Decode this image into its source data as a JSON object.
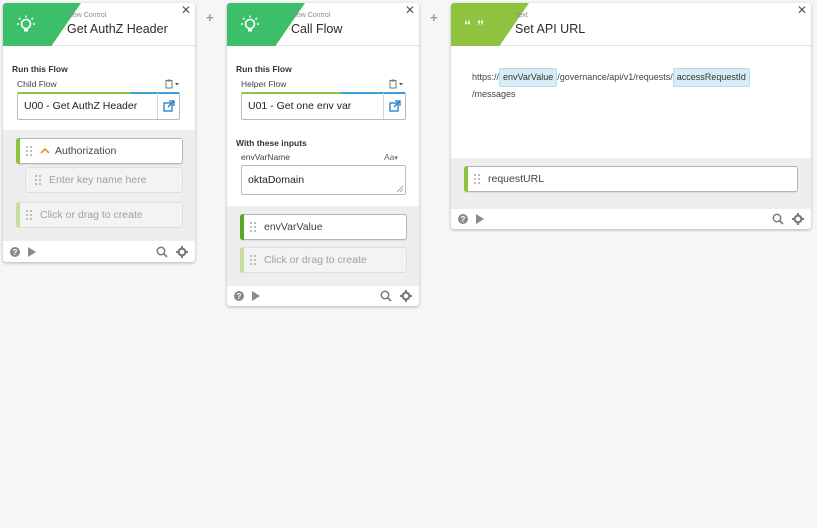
{
  "cards": [
    {
      "type_label": "Flow Control",
      "title": "Get AuthZ Header",
      "run_label": "Run this Flow",
      "field_label": "Child Flow",
      "flow_value": "U00 - Get AuthZ Header",
      "pills": {
        "key": "Authorization",
        "key_placeholder": "Enter key name here",
        "create": "Click or drag to create"
      }
    },
    {
      "type_label": "Flow Control",
      "title": "Call Flow",
      "run_label": "Run this Flow",
      "field_label": "Helper Flow",
      "flow_value": "U01 - Get one env var",
      "inputs_label": "With these inputs",
      "input_name": "envVarName",
      "input_type": "Aa",
      "input_value": "oktaDomain",
      "pills": {
        "output": "envVarValue",
        "create": "Click or drag to create"
      }
    },
    {
      "type_label": "Text",
      "title": "Set API URL",
      "badge_glyph": "“ ”",
      "template": {
        "part1": "https://",
        "token1": "envVarValue",
        "part2": "/governance/api/v1/requests/",
        "token2": "accessRequestId",
        "part3": "/messages"
      },
      "pills": {
        "output": "requestURL"
      }
    }
  ],
  "icons": [
    "lightbulb-icon",
    "quote-icon",
    "help-icon",
    "play-icon",
    "search-icon",
    "gear-icon",
    "close-icon",
    "external-link-icon",
    "clipboard-icon"
  ],
  "colors": {
    "flow_green": "#3dbf6a",
    "text_lime": "#8fc23f",
    "token_blue": "#d8ecf7"
  }
}
